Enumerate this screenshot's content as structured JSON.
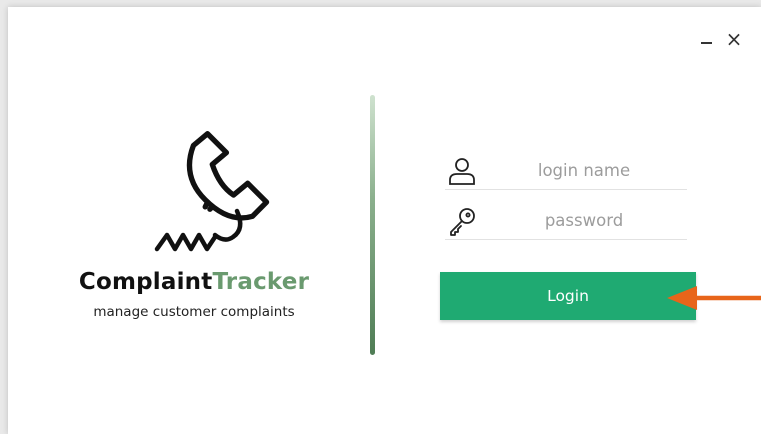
{
  "window": {
    "minimize_label": "_",
    "close_label": "×"
  },
  "brand": {
    "name_part1": "Complaint",
    "name_part2": "Tracker",
    "tagline": "manage customer complaints",
    "logo_icon": "phone-handset-icon",
    "colors": {
      "dark": "#111111",
      "green": "#6a9a6f"
    }
  },
  "form": {
    "login_name": {
      "placeholder": "login name",
      "value": "",
      "icon": "user-icon"
    },
    "password": {
      "placeholder": "password",
      "value": "",
      "icon": "key-icon"
    },
    "login_button": {
      "label": "Login",
      "color": "#1faa72"
    }
  },
  "annotation": {
    "icon": "arrow-left-icon",
    "color": "#e8651a"
  }
}
